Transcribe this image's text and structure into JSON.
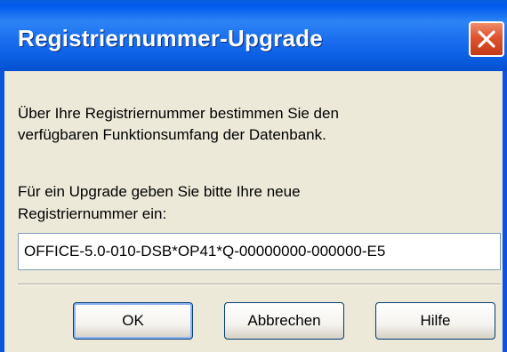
{
  "dialog": {
    "title": "Registriernummer-Upgrade",
    "close_icon": "close-icon",
    "intro_line1": "Über Ihre Registriernummer bestimmen Sie den",
    "intro_line2": "verfügbaren Funktionsumfang der Datenbank.",
    "prompt_line1": "Für ein Upgrade geben Sie bitte Ihre neue",
    "prompt_line2": "Registriernummer ein:",
    "registration_value": "OFFICE-5.0-010-DSB*OP41*Q-00000000-000000-E5"
  },
  "buttons": {
    "ok": "OK",
    "cancel": "Abbrechen",
    "help": "Hilfe"
  },
  "colors": {
    "titlebar": "#0058ee",
    "client": "#ece9d8",
    "close": "#e0532e"
  }
}
